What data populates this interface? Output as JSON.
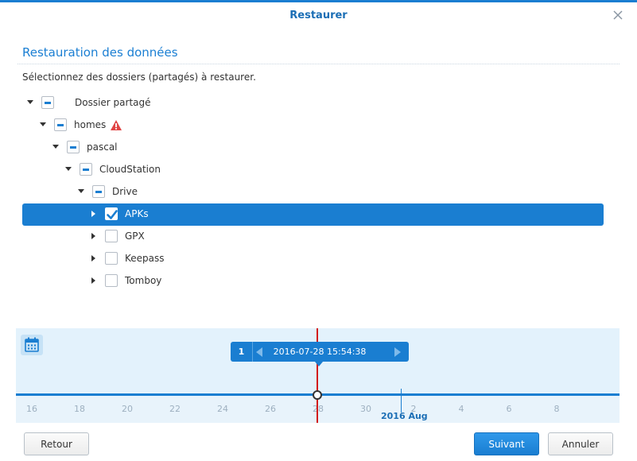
{
  "dialog": {
    "title": "Restaurer"
  },
  "section": {
    "title": "Restauration des données",
    "instruction": "Sélectionnez des dossiers (partagés) à restaurer."
  },
  "tree": [
    {
      "label": "Dossier partagé",
      "level": 0,
      "expanded": true,
      "check": "partial",
      "selected": false,
      "warning": false
    },
    {
      "label": "homes",
      "level": 1,
      "expanded": true,
      "check": "partial",
      "selected": false,
      "warning": true
    },
    {
      "label": "pascal",
      "level": 2,
      "expanded": true,
      "check": "partial",
      "selected": false,
      "warning": false
    },
    {
      "label": "CloudStation",
      "level": 3,
      "expanded": true,
      "check": "partial",
      "selected": false,
      "warning": false
    },
    {
      "label": "Drive",
      "level": 4,
      "expanded": true,
      "check": "partial",
      "selected": false,
      "warning": false
    },
    {
      "label": "APKs",
      "level": 5,
      "expanded": false,
      "check": "checked",
      "selected": true,
      "warning": false
    },
    {
      "label": "GPX",
      "level": 5,
      "expanded": false,
      "check": "unchecked",
      "selected": false,
      "warning": false
    },
    {
      "label": "Keepass",
      "level": 5,
      "expanded": false,
      "check": "unchecked",
      "selected": false,
      "warning": false
    },
    {
      "label": "Tomboy",
      "level": 5,
      "expanded": false,
      "check": "unchecked",
      "selected": false,
      "warning": false
    }
  ],
  "timeline": {
    "version_count": "1",
    "selected_datetime": "2016-07-28 15:54:38",
    "ticks": [
      "16",
      "18",
      "20",
      "22",
      "24",
      "26",
      "28",
      "30",
      "2",
      "4",
      "6",
      "8"
    ],
    "month_label": "2016 Aug"
  },
  "buttons": {
    "back": "Retour",
    "next": "Suivant",
    "cancel": "Annuler"
  },
  "colors": {
    "accent": "#1a7ed1",
    "marker": "#d21c1c",
    "warning": "#e04444",
    "timeline_bg": "#e3f2fc"
  },
  "icons": {
    "close": "close-icon",
    "calendar": "calendar-icon",
    "warning": "warning-icon"
  }
}
